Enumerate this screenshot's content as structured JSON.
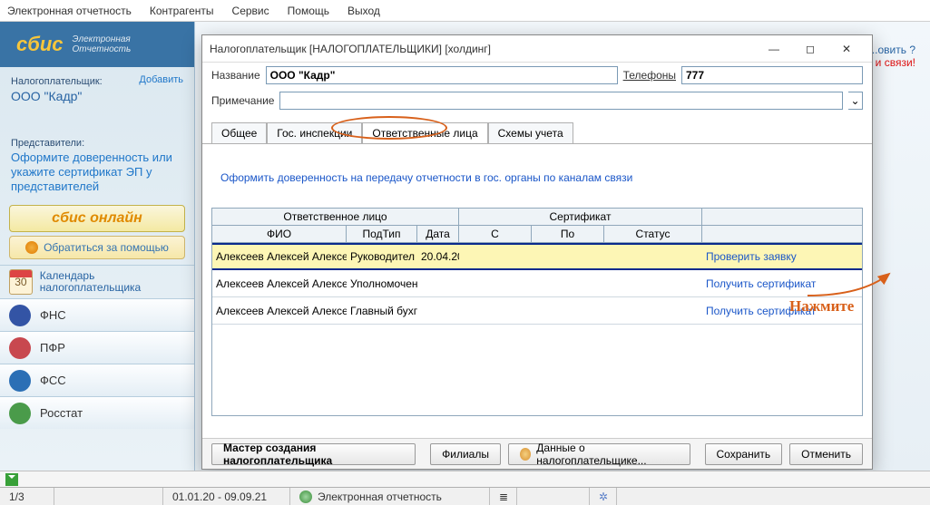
{
  "menu": {
    "items": [
      "Электронная отчетность",
      "Контрагенты",
      "Сервис",
      "Помощь",
      "Выход"
    ]
  },
  "sidebar": {
    "brand": "сбис",
    "brand_sub1": "Электронная",
    "brand_sub2": "Отчетность",
    "taxpayer_label": "Налогоплательщик:",
    "add": "Добавить",
    "org": "ООО \"Кадр\"",
    "rep_label": "Представители:",
    "rep_action": "Оформите доверенность или укажите сертификат ЭП у представителей",
    "online": "сбис онлайн",
    "help": "Обратиться за помощью",
    "calendar_day": "30",
    "calendar_label": "Календарь налогоплательщика",
    "nav": [
      "ФНС",
      "ПФР",
      "ФСС",
      "Росстат"
    ]
  },
  "background": {
    "q": "...овить ?",
    "r": "и связи!"
  },
  "modal": {
    "title": "Налогоплательщик [НАЛОГОПЛАТЕЛЬЩИКИ] [холдинг]",
    "name_label": "Название",
    "name_value": "ООО \"Кадр\"",
    "phone_label": "Телефоны",
    "phone_value": "777",
    "note_label": "Примечание",
    "note_value": "",
    "tabs": [
      "Общее",
      "Гос. инспекции",
      "Ответственные лица",
      "Схемы учета"
    ],
    "doclink": "Оформить доверенность на передачу отчетности в гос. органы по каналам связи",
    "grid": {
      "top_headers": {
        "resp": "Ответственное лицо",
        "cert": "Сертификат"
      },
      "headers": [
        "ФИО",
        "ПодТип",
        "Дата",
        "С",
        "По",
        "Статус",
        ""
      ],
      "rows": [
        {
          "fio": "Алексеев Алексей Алексее",
          "type": "Руководител",
          "date": "20.04.20",
          "c": "",
          "po": "",
          "status": "",
          "action": "Проверить заявку"
        },
        {
          "fio": "Алексеев Алексей Алексее",
          "type": "Уполномочен",
          "date": "",
          "c": "",
          "po": "",
          "status": "",
          "action": "Получить сертификат"
        },
        {
          "fio": "Алексеев Алексей Алексее",
          "type": "Главный бухг",
          "date": "",
          "c": "",
          "po": "",
          "status": "",
          "action": "Получить сертификат"
        }
      ]
    },
    "footer": {
      "wizard": "Мастер создания налогоплательщика",
      "branches": "Филиалы",
      "data": "Данные о налогоплательщике...",
      "save": "Сохранить",
      "cancel": "Отменить"
    }
  },
  "annotation": "Нажмите",
  "status": {
    "page": "1/3",
    "dates": "01.01.20 - 09.09.21",
    "app": "Электронная отчетность"
  }
}
